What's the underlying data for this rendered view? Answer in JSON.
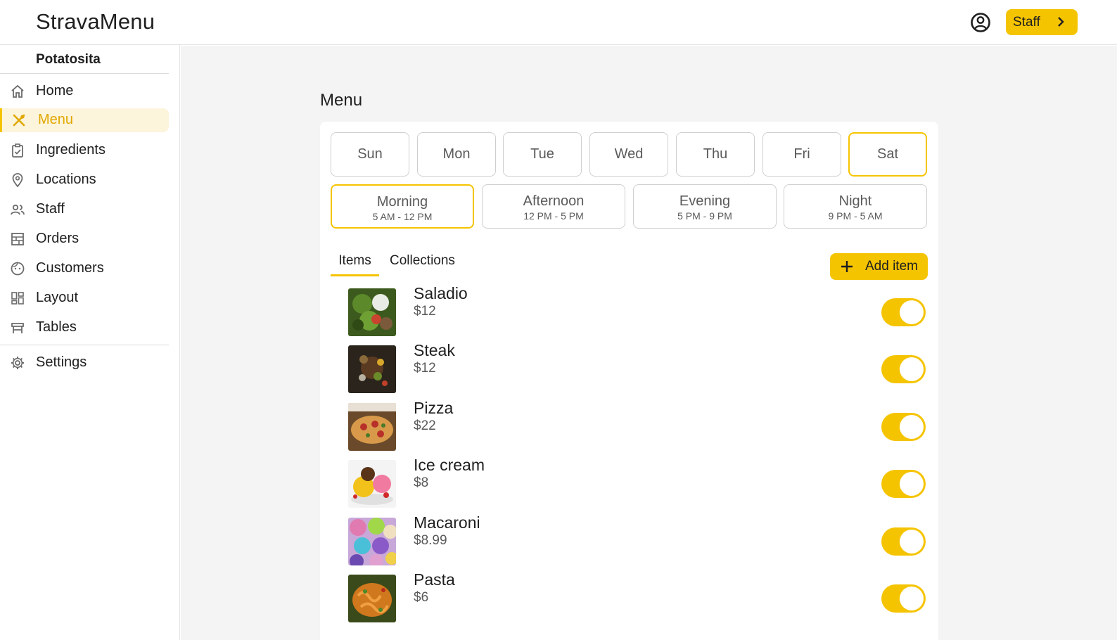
{
  "app": {
    "title": "StravaMenu"
  },
  "header": {
    "staff_label": "Staff"
  },
  "sidebar": {
    "restaurant": "Potatosita",
    "items": [
      {
        "label": "Home",
        "icon": "home-icon"
      },
      {
        "label": "Menu",
        "icon": "utensils-icon",
        "active": true
      },
      {
        "label": "Ingredients",
        "icon": "clipboard-check-icon"
      },
      {
        "label": "Locations",
        "icon": "location-pin-icon"
      },
      {
        "label": "Staff",
        "icon": "people-icon"
      },
      {
        "label": "Orders",
        "icon": "orders-icon"
      },
      {
        "label": "Customers",
        "icon": "face-icon"
      },
      {
        "label": "Layout",
        "icon": "dashboard-icon"
      },
      {
        "label": "Tables",
        "icon": "table-icon"
      }
    ],
    "settings": {
      "label": "Settings",
      "icon": "gear-icon"
    }
  },
  "main": {
    "title": "Menu",
    "days": [
      "Sun",
      "Mon",
      "Tue",
      "Wed",
      "Thu",
      "Fri",
      "Sat"
    ],
    "selected_day": "Sat",
    "slots": [
      {
        "name": "Morning",
        "time": "5 AM - 12 PM"
      },
      {
        "name": "Afternoon",
        "time": "12 PM - 5 PM"
      },
      {
        "name": "Evening",
        "time": "5 PM - 9 PM"
      },
      {
        "name": "Night",
        "time": "9 PM - 5 AM"
      }
    ],
    "selected_slot": "Morning",
    "tabs": [
      "Items",
      "Collections"
    ],
    "active_tab": "Items",
    "add_label": "Add item",
    "items": [
      {
        "name": "Saladio",
        "price": "$12",
        "enabled": true
      },
      {
        "name": "Steak",
        "price": "$12",
        "enabled": true
      },
      {
        "name": "Pizza",
        "price": "$22",
        "enabled": true
      },
      {
        "name": "Ice cream",
        "price": "$8",
        "enabled": true
      },
      {
        "name": "Macaroni",
        "price": "$8.99",
        "enabled": true
      },
      {
        "name": "Pasta",
        "price": "$6",
        "enabled": true
      }
    ]
  },
  "colors": {
    "accent": "#f5c400",
    "active_bg": "#fdf4dc",
    "page_bg": "#f4f4f4"
  }
}
